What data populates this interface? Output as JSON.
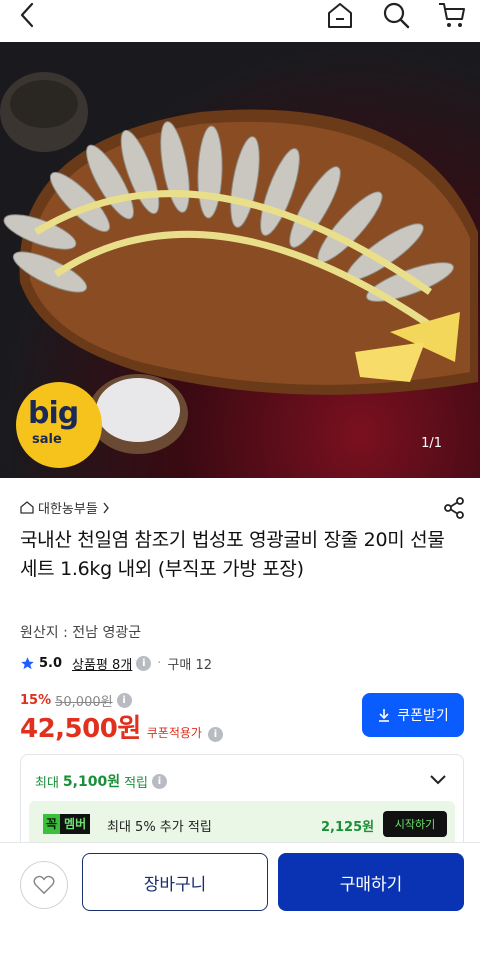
{
  "header": {
    "back_icon": "chevron-left-icon",
    "home_icon": "home-icon",
    "search_icon": "search-icon",
    "cart_icon": "cart-icon"
  },
  "gallery": {
    "counter": "1/1",
    "badge_big": "big",
    "badge_sale": "sale"
  },
  "product": {
    "seller": "대한농부들",
    "title": "국내산 천일염 참조기 법성포 영광굴비 장줄 20미 선물세트 1.6kg 내외 (부직포 가방 포장)",
    "origin": "원산지 : 전남 영광군",
    "rating": "5.0",
    "reviews": "상품평 8개",
    "purchase_count": "구매 12",
    "discount_rate": "15%",
    "original_price": "50,000원",
    "price": "42,500원",
    "coupon_applied": "쿠폰적용가",
    "coupon_button": "쿠폰받기"
  },
  "points": {
    "max_prefix": "최대",
    "max_amount": "5,100원",
    "max_suffix": "적립",
    "member_tag_1": "꼭",
    "member_tag_2": "멤버",
    "member_text": "최대 5% 추가 적립",
    "member_amount": "2,125원",
    "start_button": "시작하기"
  },
  "actions": {
    "wish_icon": "heart-icon",
    "cart_button": "장바구니",
    "buy_button": "구매하기"
  },
  "colors": {
    "accent_red": "#e0301e",
    "primary_blue": "#0a33b4",
    "coupon_blue": "#0a5cff",
    "points_green": "#1a8f3a",
    "rating_star": "#1e5eff"
  }
}
